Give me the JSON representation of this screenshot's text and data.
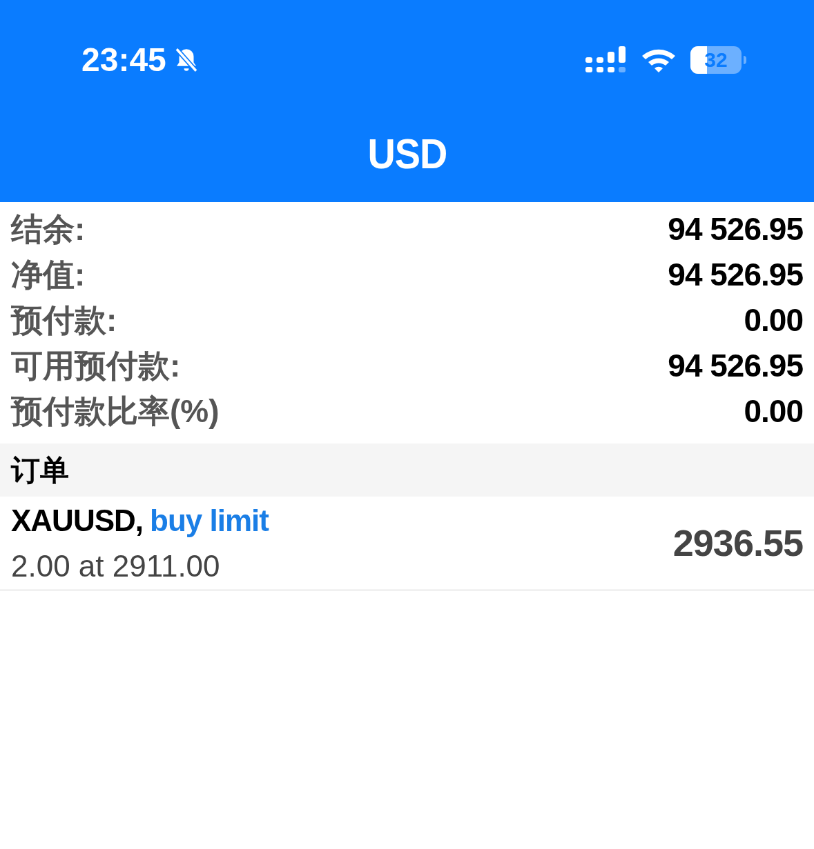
{
  "status_bar": {
    "time": "23:45",
    "battery": "32"
  },
  "title": "USD",
  "account": [
    {
      "label": "结余:",
      "value": "94 526.95"
    },
    {
      "label": "净值:",
      "value": "94 526.95"
    },
    {
      "label": "预付款:",
      "value": "0.00"
    },
    {
      "label": "可用预付款:",
      "value": "94 526.95"
    },
    {
      "label": "预付款比率(%)",
      "value": "0.00"
    }
  ],
  "orders_section": {
    "title": "订单"
  },
  "orders": [
    {
      "symbol": "XAUUSD,",
      "type": "buy limit",
      "detail": "2.00 at 2911.00",
      "price": "2936.55"
    }
  ]
}
